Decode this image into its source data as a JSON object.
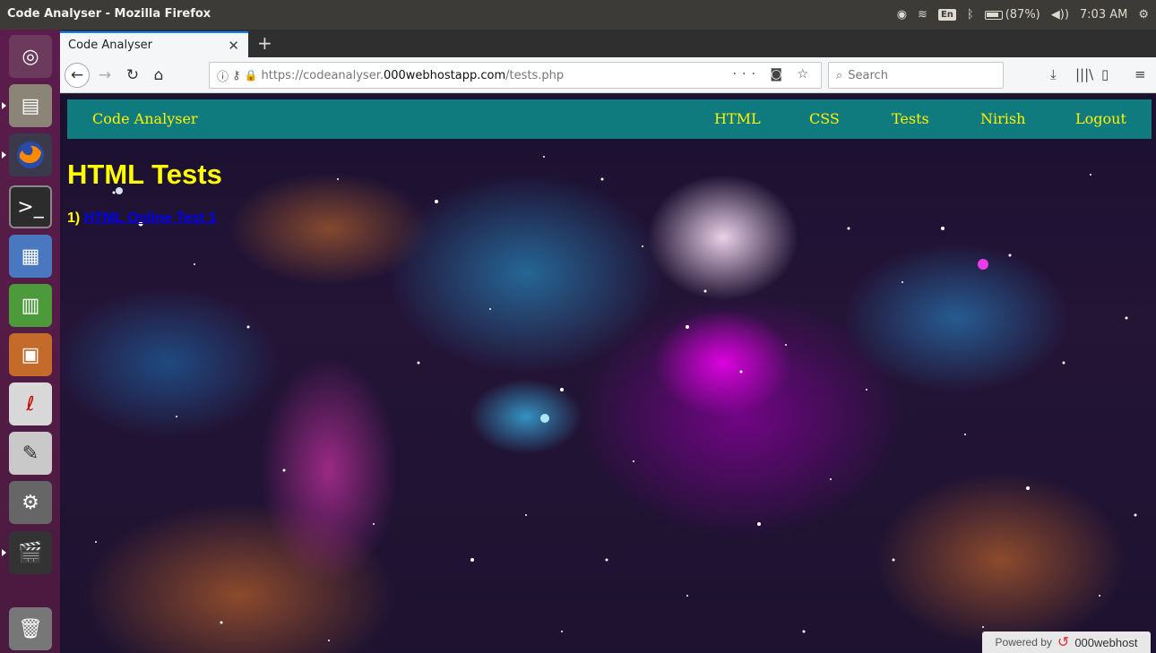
{
  "window": {
    "title": "Code Analyser - Mozilla Firefox"
  },
  "tray": {
    "language": "En",
    "battery": "(87%)",
    "time": "7:03 AM"
  },
  "launcher": {
    "items": [
      {
        "name": "ubuntu-dash",
        "icon": "ubuntu-logo-icon"
      },
      {
        "name": "files",
        "icon": "file-cabinet-icon"
      },
      {
        "name": "firefox",
        "icon": "firefox-icon"
      },
      {
        "name": "terminal",
        "icon": "terminal-icon"
      },
      {
        "name": "writer",
        "icon": "document-icon"
      },
      {
        "name": "calc",
        "icon": "spreadsheet-icon"
      },
      {
        "name": "impress",
        "icon": "presentation-icon"
      },
      {
        "name": "pdf-reader",
        "icon": "pdf-reader-icon"
      },
      {
        "name": "text-editor",
        "icon": "text-editor-icon"
      },
      {
        "name": "system-settings",
        "icon": "settings-icon"
      },
      {
        "name": "video-editor",
        "icon": "clapperboard-icon"
      },
      {
        "name": "trash",
        "icon": "trash-icon"
      }
    ]
  },
  "browser": {
    "tab_title": "Code Analyser",
    "url_prefix": "https://codeanalyser.",
    "url_domain": "000webhostapp.com",
    "url_path": "/tests.php",
    "search_placeholder": "Search"
  },
  "site": {
    "brand": "Code Analyser",
    "nav": [
      "HTML",
      "CSS",
      "Tests",
      "Nirish",
      "Logout"
    ],
    "heading": "HTML Tests",
    "tests": [
      {
        "number": "1)",
        "label": "HTML Online Test 1"
      }
    ],
    "powered_by": "Powered by",
    "host_brand": "000webhost"
  },
  "colors": {
    "nav_bg": "#0f7b7e",
    "nav_text": "#fff200",
    "heading": "#ffff00",
    "link": "#0000ee",
    "launcher_bg": "#5c1d4c"
  }
}
